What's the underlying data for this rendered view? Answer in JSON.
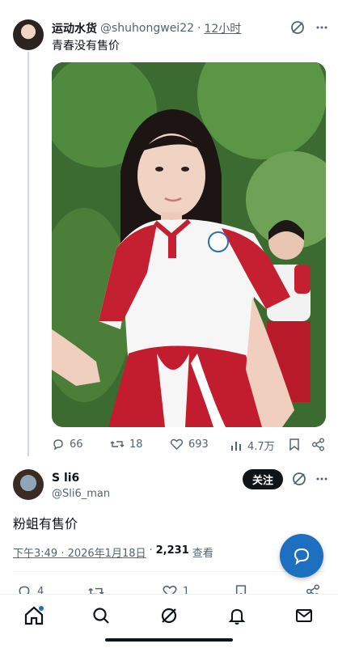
{
  "tweet": {
    "author_name": "运动水货",
    "author_handle": "@shuhongwei22",
    "separator": "·",
    "time": "12小时",
    "text": "青春没有售价",
    "stats": {
      "replies": "66",
      "retweets": "18",
      "likes": "693",
      "views": "4.7万"
    }
  },
  "reply": {
    "author_name": "S li6",
    "author_handle": "@Sli6_man",
    "follow_label": "关注",
    "text": "粉蛆有售价",
    "timestamp": "下午3:49 · 2026年1月18日",
    "views_count": "2,231",
    "views_label": "查看",
    "dot": "·",
    "stats": {
      "replies": "4",
      "likes": "1"
    }
  },
  "colors": {
    "accent": "#1d6fc0",
    "text": "#0f1419",
    "muted": "#536471"
  },
  "icons": [
    "grok-icon",
    "reply-icon",
    "retweet-icon",
    "like-icon",
    "views-icon",
    "bookmark-icon",
    "share-icon",
    "home-icon",
    "search-icon",
    "bell-icon",
    "mail-icon",
    "chat-icon"
  ]
}
